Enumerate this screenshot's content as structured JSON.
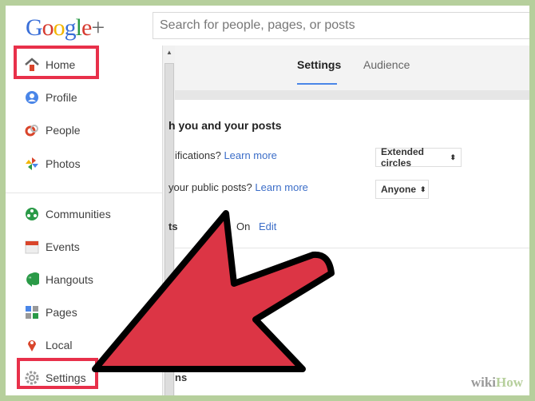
{
  "header": {
    "logo": "Google+",
    "search_placeholder": "Search for people, pages, or posts"
  },
  "sidebar": {
    "items": [
      {
        "label": "Home",
        "icon": "home-icon"
      },
      {
        "label": "Profile",
        "icon": "profile-icon"
      },
      {
        "label": "People",
        "icon": "people-icon"
      },
      {
        "label": "Photos",
        "icon": "photos-icon"
      },
      {
        "label": "Communities",
        "icon": "communities-icon"
      },
      {
        "label": "Events",
        "icon": "events-icon"
      },
      {
        "label": "Hangouts",
        "icon": "hangouts-icon"
      },
      {
        "label": "Pages",
        "icon": "pages-icon"
      },
      {
        "label": "Local",
        "icon": "local-icon"
      },
      {
        "label": "Settings",
        "icon": "gear-icon"
      }
    ]
  },
  "tabs": [
    {
      "label": "Settings",
      "active": true
    },
    {
      "label": "Audience",
      "active": false
    }
  ],
  "settings": {
    "section_title": "h you and your posts",
    "row1_text": "ifications?",
    "row1_link": "Learn more",
    "row1_value": "Extended circles",
    "row2_text": "your public posts?",
    "row2_link": "Learn more",
    "row2_value": "Anyone",
    "row3_label": "ts",
    "row3_value": "On",
    "row3_link": "Edit",
    "bottom_fragment": "ns"
  },
  "colors": {
    "highlight": "#e8304a",
    "arrow": "#dc3545",
    "border": "#b6cf9c",
    "link": "#3c6ec8"
  },
  "watermark": "wikiHow"
}
